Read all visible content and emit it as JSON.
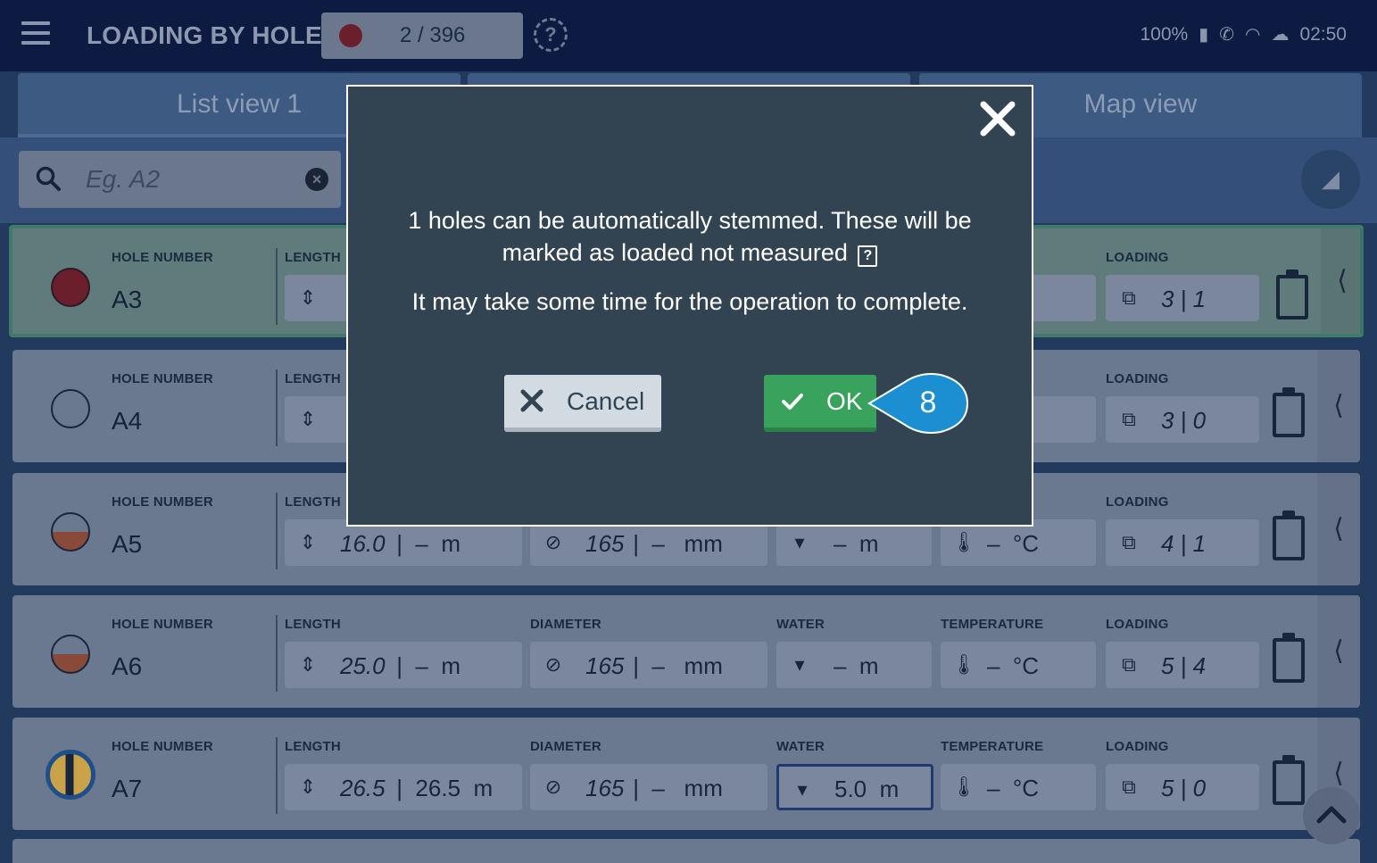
{
  "header": {
    "title": "LOADING BY HOLE",
    "counter": "2 / 396",
    "help_icon": "help-circle-icon",
    "battery": "100%",
    "time": "02:50",
    "icons": [
      "battery-icon",
      "phone-icon",
      "wifi-icon",
      "cloud-icon"
    ]
  },
  "tabs": [
    {
      "label": "List view 1"
    },
    {
      "label": ""
    },
    {
      "label": "Map view"
    }
  ],
  "search": {
    "placeholder": "Eg. A2"
  },
  "labels": {
    "hole_number": "HOLE NUMBER",
    "length": "LENGTH",
    "diameter": "DIAMETER",
    "water": "WATER",
    "temperature": "TEMPERATURE",
    "loading": "LOADING"
  },
  "rows": [
    {
      "hole": "A3",
      "length": "",
      "diameter": "",
      "water": "",
      "temperature": "",
      "loading": "3 | 1",
      "status": "red-filled"
    },
    {
      "hole": "A4",
      "length": "",
      "diameter": "",
      "water": "",
      "temperature": "",
      "loading": "3 | 0",
      "status": "empty"
    },
    {
      "hole": "A5",
      "length": "16.0",
      "length_unit": " |  –  m",
      "diameter": "165",
      "diameter_unit": " |  –   mm",
      "water": "–  m",
      "temperature": "–  °C",
      "loading": "4 | 1",
      "status": "half-brown"
    },
    {
      "hole": "A6",
      "length": "25.0",
      "length_unit": " |  –  m",
      "diameter": "165",
      "diameter_unit": " |  –   mm",
      "water": "–  m",
      "temperature": "–  °C",
      "loading": "5 | 4",
      "status": "half-brown"
    },
    {
      "hole": "A7",
      "length": "26.5",
      "length_unit": " |  26.5  m",
      "diameter": "165",
      "diameter_unit": " |  –   mm",
      "water": "5.0  m",
      "temperature": "–  °C",
      "loading": "5 | 0",
      "status": "stemmed"
    }
  ],
  "dialog": {
    "message_line1": "1 holes can be automatically stemmed. These will be marked as loaded not measured",
    "badge": "?",
    "message_line2": "It may take some time for the operation to complete.",
    "cancel_label": "Cancel",
    "ok_label": "OK"
  },
  "callout": {
    "number": "8",
    "color": "#1b8fd2"
  },
  "colors": {
    "accent_green": "#39a35e",
    "modal_bg": "#324452",
    "header_bg": "#0d1b42"
  }
}
